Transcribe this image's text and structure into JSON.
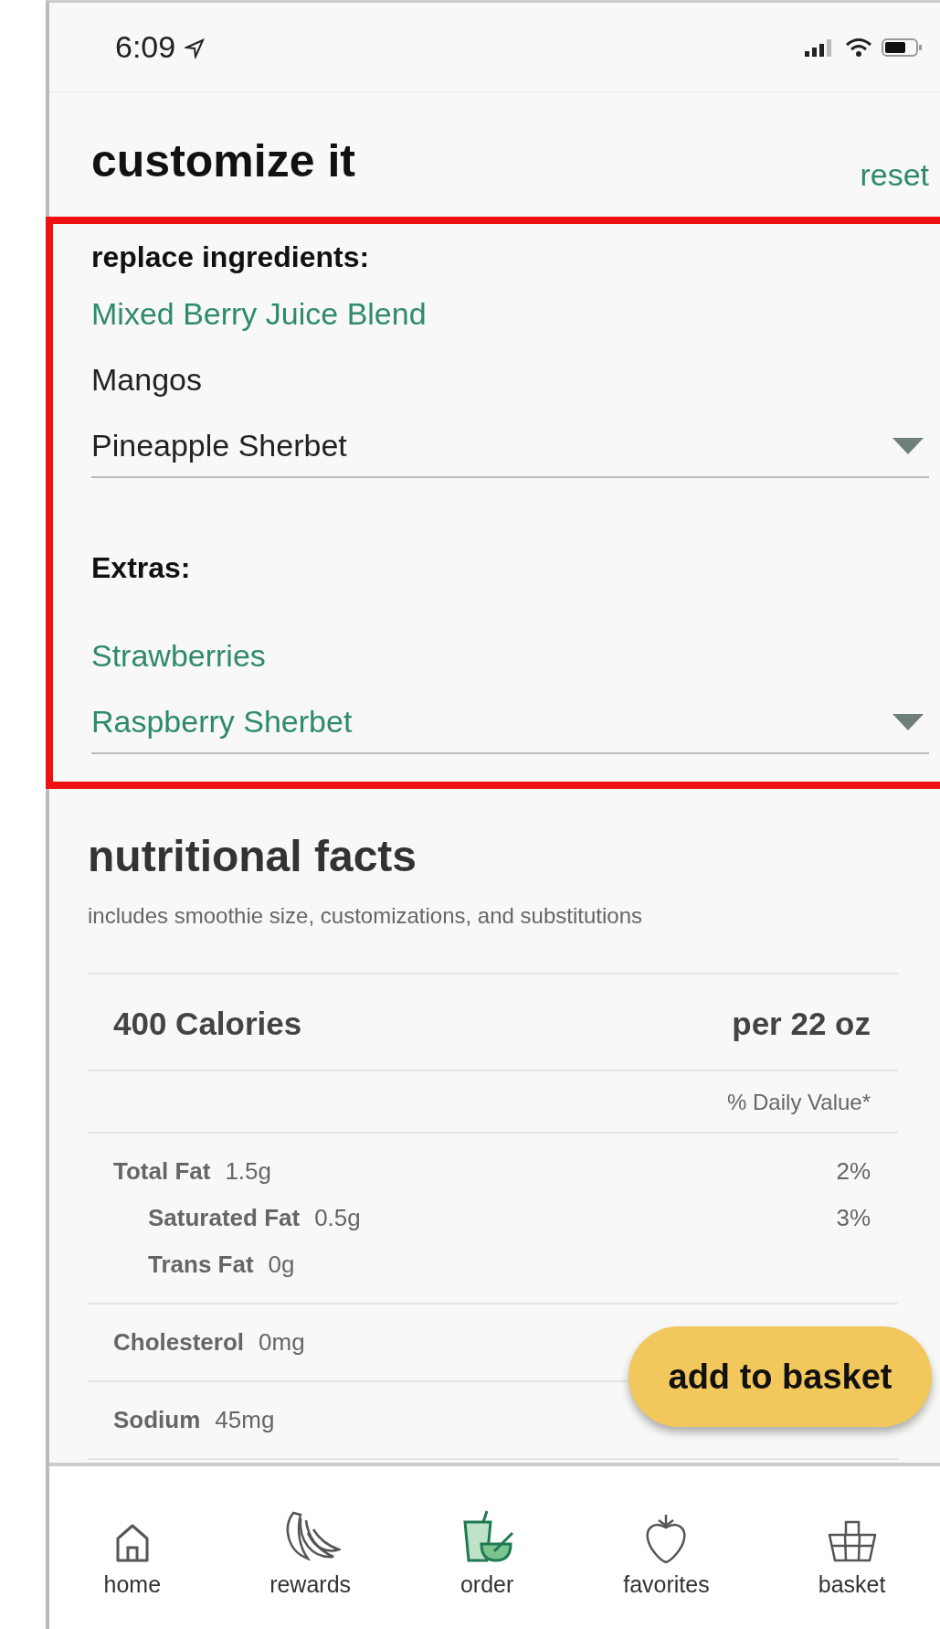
{
  "status_bar": {
    "time": "6:09"
  },
  "customize": {
    "title": "customize it",
    "reset": "reset",
    "sections": [
      {
        "heading": "replace ingredients:",
        "items": [
          {
            "label": "Mixed Berry Juice Blend",
            "kind": "item",
            "selected": true
          },
          {
            "label": "Mangos",
            "kind": "item",
            "selected": false
          },
          {
            "label": "Pineapple Sherbet",
            "kind": "dropdown",
            "selected": false
          }
        ]
      },
      {
        "heading": "Extras:",
        "items": [
          {
            "label": "Strawberries",
            "kind": "item",
            "selected": true
          },
          {
            "label": "Raspberry Sherbet",
            "kind": "dropdown",
            "selected": true
          }
        ]
      }
    ]
  },
  "nutrition": {
    "title": "nutritional facts",
    "subtitle": "includes smoothie size, customizations, and substitutions",
    "calories": "400 Calories",
    "serving": "per 22 oz",
    "daily_value_header": "% Daily Value*",
    "groups": [
      [
        {
          "name": "Total Fat",
          "amount": "1.5g",
          "percent": "2%",
          "kind": "main"
        },
        {
          "name": "Saturated Fat",
          "amount": "0.5g",
          "percent": "3%",
          "kind": "sub"
        },
        {
          "name": "Trans Fat",
          "amount": "0g",
          "kind": "sub"
        }
      ],
      [
        {
          "name": "Cholesterol",
          "amount": "0mg",
          "kind": "main"
        }
      ],
      [
        {
          "name": "Sodium",
          "amount": "45mg",
          "kind": "main"
        }
      ]
    ]
  },
  "add_button": "add to basket",
  "tab_bar": [
    {
      "label": "home",
      "kind": "home",
      "selected": false
    },
    {
      "label": "rewards",
      "kind": "bananas",
      "selected": false
    },
    {
      "label": "order",
      "kind": "cup",
      "selected": true
    },
    {
      "label": "favorites",
      "kind": "strawberry",
      "selected": false
    },
    {
      "label": "basket",
      "kind": "basket",
      "selected": false
    }
  ]
}
